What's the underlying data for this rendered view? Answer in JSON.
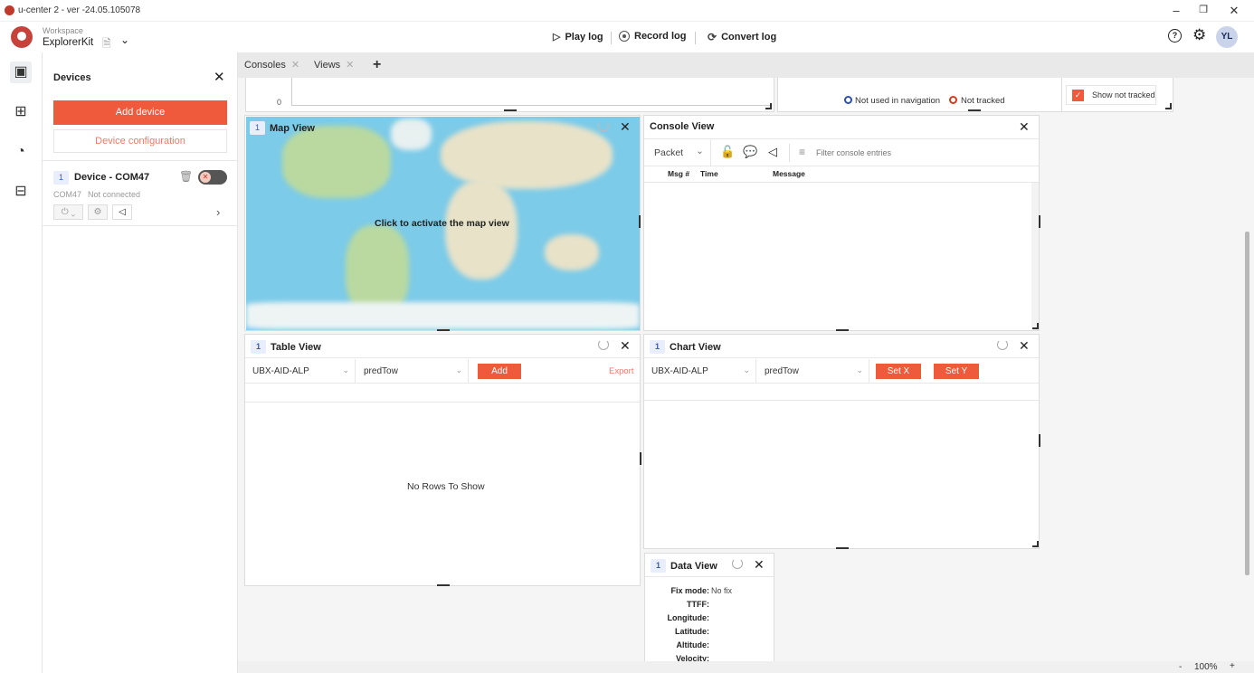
{
  "window": {
    "title": "u-center 2 - ver -24.05.105078"
  },
  "header": {
    "workspace_label": "Workspace",
    "workspace_name": "ExplorerKit",
    "play_log": "Play log",
    "record_log": "Record log",
    "convert_log": "Convert log",
    "avatar_initials": "YL"
  },
  "devices": {
    "title": "Devices",
    "add_device": "Add device",
    "device_configuration": "Device configuration",
    "device": {
      "index": "1",
      "name": "Device - COM47",
      "port": "COM47",
      "status": "Not connected"
    }
  },
  "tabs": [
    {
      "label": "Consoles"
    },
    {
      "label": "Views"
    }
  ],
  "top_strip": {
    "y_zero": "0",
    "legend_not_used": "Not used in navigation",
    "legend_not_tracked": "Not tracked",
    "show_not_tracked": "Show not tracked"
  },
  "map_view": {
    "index": "1",
    "title": "Map View",
    "overlay": "Click to activate the map view"
  },
  "console_view": {
    "title": "Console View",
    "filter_mode": "Packet",
    "filter_placeholder": "Filter console entries",
    "columns": [
      "Msg #",
      "Time",
      "Message"
    ]
  },
  "table_view": {
    "index": "1",
    "title": "Table View",
    "message": "UBX-AID-ALP",
    "field": "predTow",
    "add": "Add",
    "export": "Export",
    "empty": "No Rows To Show"
  },
  "chart_view": {
    "index": "1",
    "title": "Chart View",
    "message": "UBX-AID-ALP",
    "field": "predTow",
    "set_x": "Set X",
    "set_y": "Set Y"
  },
  "data_view": {
    "index": "1",
    "title": "Data View",
    "rows": [
      {
        "label": "Fix mode:",
        "value": "No fix"
      },
      {
        "label": "TTFF:",
        "value": ""
      },
      {
        "label": "Longitude:",
        "value": ""
      },
      {
        "label": "Latitude:",
        "value": ""
      },
      {
        "label": "Altitude:",
        "value": ""
      },
      {
        "label": "Velocity:",
        "value": ""
      }
    ]
  },
  "statusbar": {
    "zoom": "100%"
  },
  "colors": {
    "accent": "#f05a3c",
    "nav_blue": "#2d4fb4",
    "not_tracked_red": "#d9381e"
  }
}
